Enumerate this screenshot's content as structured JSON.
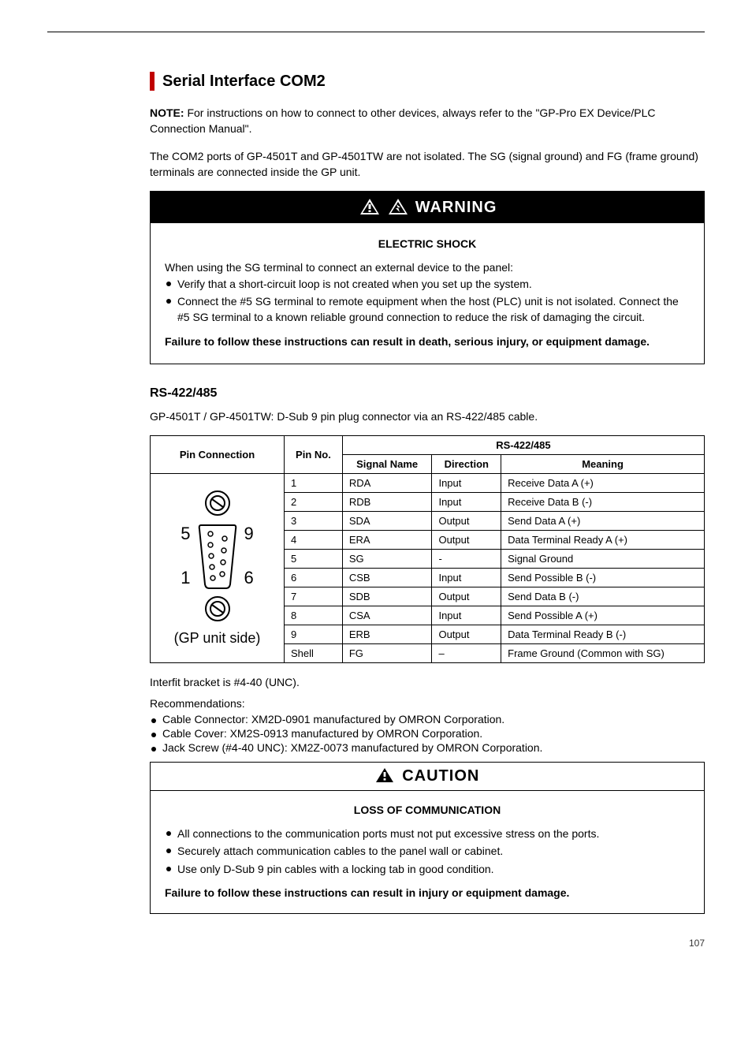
{
  "heading": "Serial Interface COM2",
  "intro_note_label": "NOTE: ",
  "intro_note_text": "For instructions on how to connect to other devices, always refer to the \"GP-Pro EX Device/PLC Connection Manual\".",
  "intro_para2": "The COM2 ports of GP-4501T and GP-4501TW are not isolated. The SG (signal ground) and FG (frame ground) terminals are connected inside the GP unit.",
  "warning": {
    "title": "WARNING",
    "subhead": "ELECTRIC SHOCK",
    "lead": "When using the SG terminal to connect an external device to the panel:",
    "items": [
      "Verify that a short-circuit loop is not created when you set up the system.",
      "Connect the #5 SG terminal to remote equipment when the host (PLC) unit is not isolated. Connect the #5 SG terminal to a known reliable ground connection to reduce the risk of damaging the circuit."
    ],
    "footer": "Failure to follow these instructions can result in death, serious injury, or equipment damage."
  },
  "rs422": {
    "title": "RS-422/485",
    "caption": "GP-4501T / GP-4501TW: D-Sub 9 pin plug connector via an RS-422/485 cable.",
    "headers": {
      "pin": "Pin Connection",
      "pinno": "Pin No.",
      "sig": "Signal Name",
      "dir": "Direction",
      "mean": "Meaning",
      "rs": "RS-422/485"
    },
    "diagram_label": "(GP unit side)",
    "digits": {
      "d5": "5",
      "d9": "9",
      "d1": "1",
      "d6": "6"
    },
    "rows": [
      {
        "no": "1",
        "sig": "RDA",
        "dir": "Input",
        "mean": "Receive Data A (+)"
      },
      {
        "no": "2",
        "sig": "RDB",
        "dir": "Input",
        "mean": "Receive Data B (-)"
      },
      {
        "no": "3",
        "sig": "SDA",
        "dir": "Output",
        "mean": "Send Data A (+)"
      },
      {
        "no": "4",
        "sig": "ERA",
        "dir": "Output",
        "mean": "Data Terminal Ready A (+)"
      },
      {
        "no": "5",
        "sig": "SG",
        "dir": "-",
        "mean": "Signal Ground"
      },
      {
        "no": "6",
        "sig": "CSB",
        "dir": "Input",
        "mean": "Send Possible B (-)"
      },
      {
        "no": "7",
        "sig": "SDB",
        "dir": "Output",
        "mean": "Send Data B (-)"
      },
      {
        "no": "8",
        "sig": "CSA",
        "dir": "Input",
        "mean": "Send Possible A (+)"
      },
      {
        "no": "9",
        "sig": "ERB",
        "dir": "Output",
        "mean": "Data Terminal Ready B (-)"
      },
      {
        "no": "Shell",
        "sig": "FG",
        "dir": "–",
        "mean": "Frame Ground (Common with SG)"
      }
    ]
  },
  "interfit": "Interfit bracket is #4-40 (UNC).",
  "recs_label": "Recommendations:",
  "recs": [
    "Cable Connector: XM2D-0901 manufactured by OMRON Corporation.",
    "Cable Cover: XM2S-0913 manufactured by OMRON Corporation.",
    "Jack Screw (#4-40 UNC): XM2Z-0073 manufactured by OMRON Corporation."
  ],
  "caution": {
    "title": "CAUTION",
    "subhead": "LOSS OF COMMUNICATION",
    "items": [
      "All connections to the communication ports must not put excessive stress on the ports.",
      "Securely attach communication cables to the panel wall or cabinet.",
      "Use only D-Sub 9 pin cables with a locking tab in good condition."
    ],
    "footer": "Failure to follow these instructions can result in injury or equipment damage."
  },
  "page_num": "107"
}
